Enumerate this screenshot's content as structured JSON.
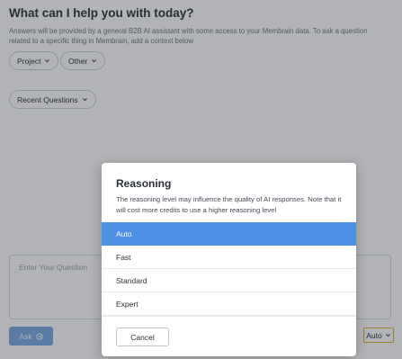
{
  "header": {
    "title": "What can I help you with today?",
    "subtitle": "Answers will be provided by a general B2B AI assistant with some access to your Membrain data. To ask a question related to a specific thing in Membrain, add a context below"
  },
  "context": {
    "project_label": "Project",
    "other_label": "Other"
  },
  "recent": {
    "label": "Recent Questions"
  },
  "question": {
    "placeholder": "Enter Your Question"
  },
  "footer": {
    "ask_label": "Ask",
    "reasoning_value": "Auto"
  },
  "modal": {
    "title": "Reasoning",
    "description": "The reasoning level may influence the quality of AI responses. Note that it will cost more credits to use a higher reasoning level",
    "options": [
      {
        "label": "Auto",
        "selected": true
      },
      {
        "label": "Fast",
        "selected": false
      },
      {
        "label": "Standard",
        "selected": false
      },
      {
        "label": "Expert",
        "selected": false
      }
    ],
    "cancel_label": "Cancel"
  },
  "colors": {
    "accent": "#4d8fe5",
    "ask_button": "#7aa7e6",
    "reasoning_highlight": "#e2a92a"
  }
}
